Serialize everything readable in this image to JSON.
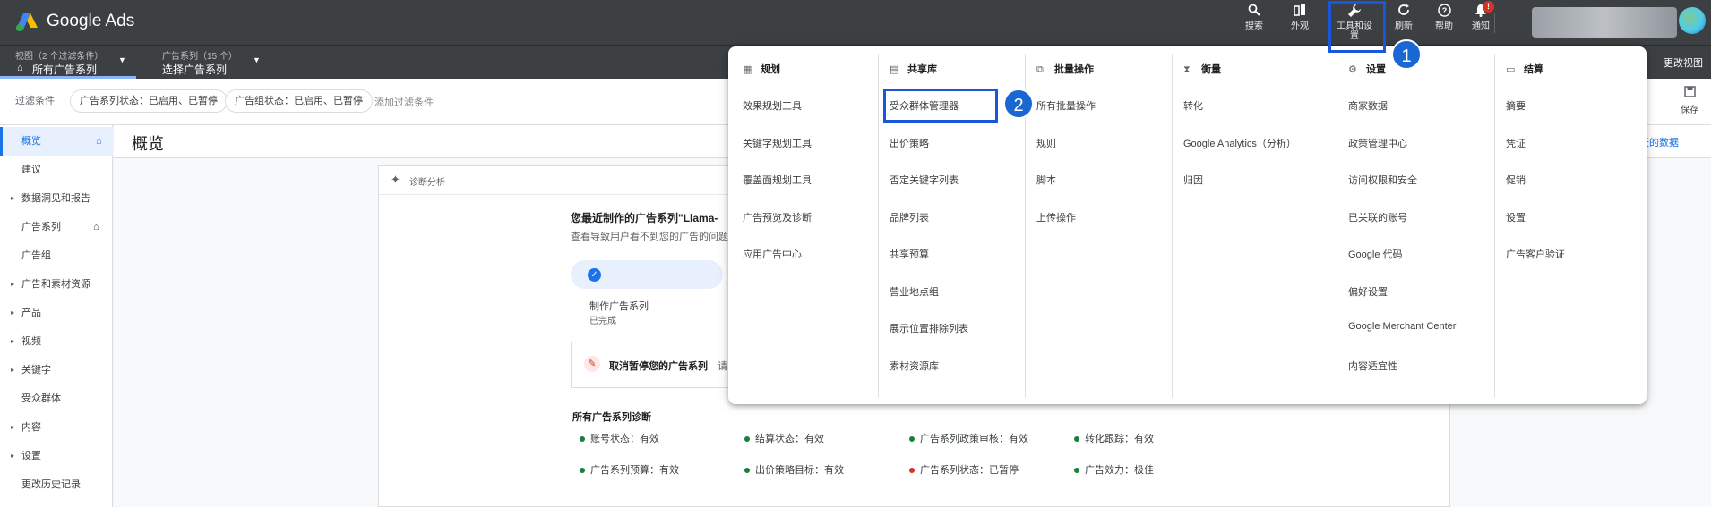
{
  "app": {
    "logo_text": "Google Ads"
  },
  "top_actions": [
    {
      "label": "搜索",
      "icon": "search-icon"
    },
    {
      "label": "外观",
      "icon": "appearance-icon"
    },
    {
      "label": "工具和设置",
      "icon": "wrench-icon"
    },
    {
      "label": "刷新",
      "icon": "refresh-icon"
    },
    {
      "label": "帮助",
      "icon": "help-icon"
    },
    {
      "label": "通知",
      "icon": "bell-icon",
      "badge": "!"
    }
  ],
  "view_selector": {
    "meta": "视图（2 个过滤条件）",
    "value": "所有广告系列"
  },
  "campaign_selector": {
    "meta": "广告系列（15 个）",
    "value": "选择广告系列"
  },
  "change_view": "更改视图",
  "filters": {
    "label": "过滤条件",
    "chips": [
      "广告系列状态：已启用、已暂停",
      "广告组状态：已启用、已暂停"
    ],
    "add": "添加过滤条件",
    "save": "保存"
  },
  "nav": [
    "概览",
    "建议",
    "数据洞见和报告",
    "广告系列",
    "广告组",
    "广告和素材资源",
    "产品",
    "视频",
    "关键字",
    "受众群体",
    "内容",
    "设置",
    "更改历史记录"
  ],
  "page_title": "概览",
  "date_link": "天的数据",
  "card": {
    "header": "诊断分析",
    "headline": "您最近制作的广告系列\"Llama-",
    "subline": "查看导致用户看不到您的广告的问题",
    "step_name": "制作广告系列",
    "step_status": "已完成",
    "resume_title": "取消暂停您的广告系列",
    "resume_hint": "请",
    "diag_title": "所有广告系列诊断",
    "diagnostics": [
      {
        "text": "账号状态：有效",
        "status": "ok"
      },
      {
        "text": "结算状态：有效",
        "status": "ok"
      },
      {
        "text": "广告系列政策审核：有效",
        "status": "ok"
      },
      {
        "text": "转化跟踪：有效",
        "status": "ok"
      },
      {
        "text": "广告系列预算：有效",
        "status": "ok"
      },
      {
        "text": "出价策略目标：有效",
        "status": "ok"
      },
      {
        "text": "广告系列状态：已暂停",
        "status": "bad"
      },
      {
        "text": "广告效力：极佳",
        "status": "ok"
      }
    ]
  },
  "menu": {
    "columns": [
      {
        "title": "规划",
        "icon": "calendar-icon",
        "items": [
          "效果规划工具",
          "关键字规划工具",
          "覆盖面规划工具",
          "广告预览及诊断",
          "应用广告中心"
        ]
      },
      {
        "title": "共享库",
        "icon": "library-icon",
        "items": [
          "受众群体管理器",
          "出价策略",
          "否定关键字列表",
          "品牌列表",
          "共享预算",
          "营业地点组",
          "展示位置排除列表",
          "素材资源库"
        ]
      },
      {
        "title": "批量操作",
        "icon": "copy-icon",
        "items": [
          "所有批量操作",
          "规则",
          "脚本",
          "上传操作"
        ]
      },
      {
        "title": "衡量",
        "icon": "hourglass-icon",
        "items": [
          "转化",
          "Google Analytics（分析）",
          "归因"
        ]
      },
      {
        "title": "设置",
        "icon": "settings-icon",
        "items": [
          "商家数据",
          "政策管理中心",
          "访问权限和安全",
          "已关联的账号",
          "Google 代码",
          "偏好设置",
          "Google Merchant Center",
          "内容适宜性"
        ]
      },
      {
        "title": "结算",
        "icon": "card-icon",
        "items": [
          "摘要",
          "凭证",
          "促销",
          "设置",
          "广告客户验证"
        ]
      }
    ]
  },
  "annotations": {
    "step1": "1",
    "step2": "2"
  },
  "colors": {
    "topbar": "#3c4043",
    "accent": "#1a73e8",
    "annotation": "#1967d2",
    "ok": "#188038",
    "bad": "#d93025"
  }
}
